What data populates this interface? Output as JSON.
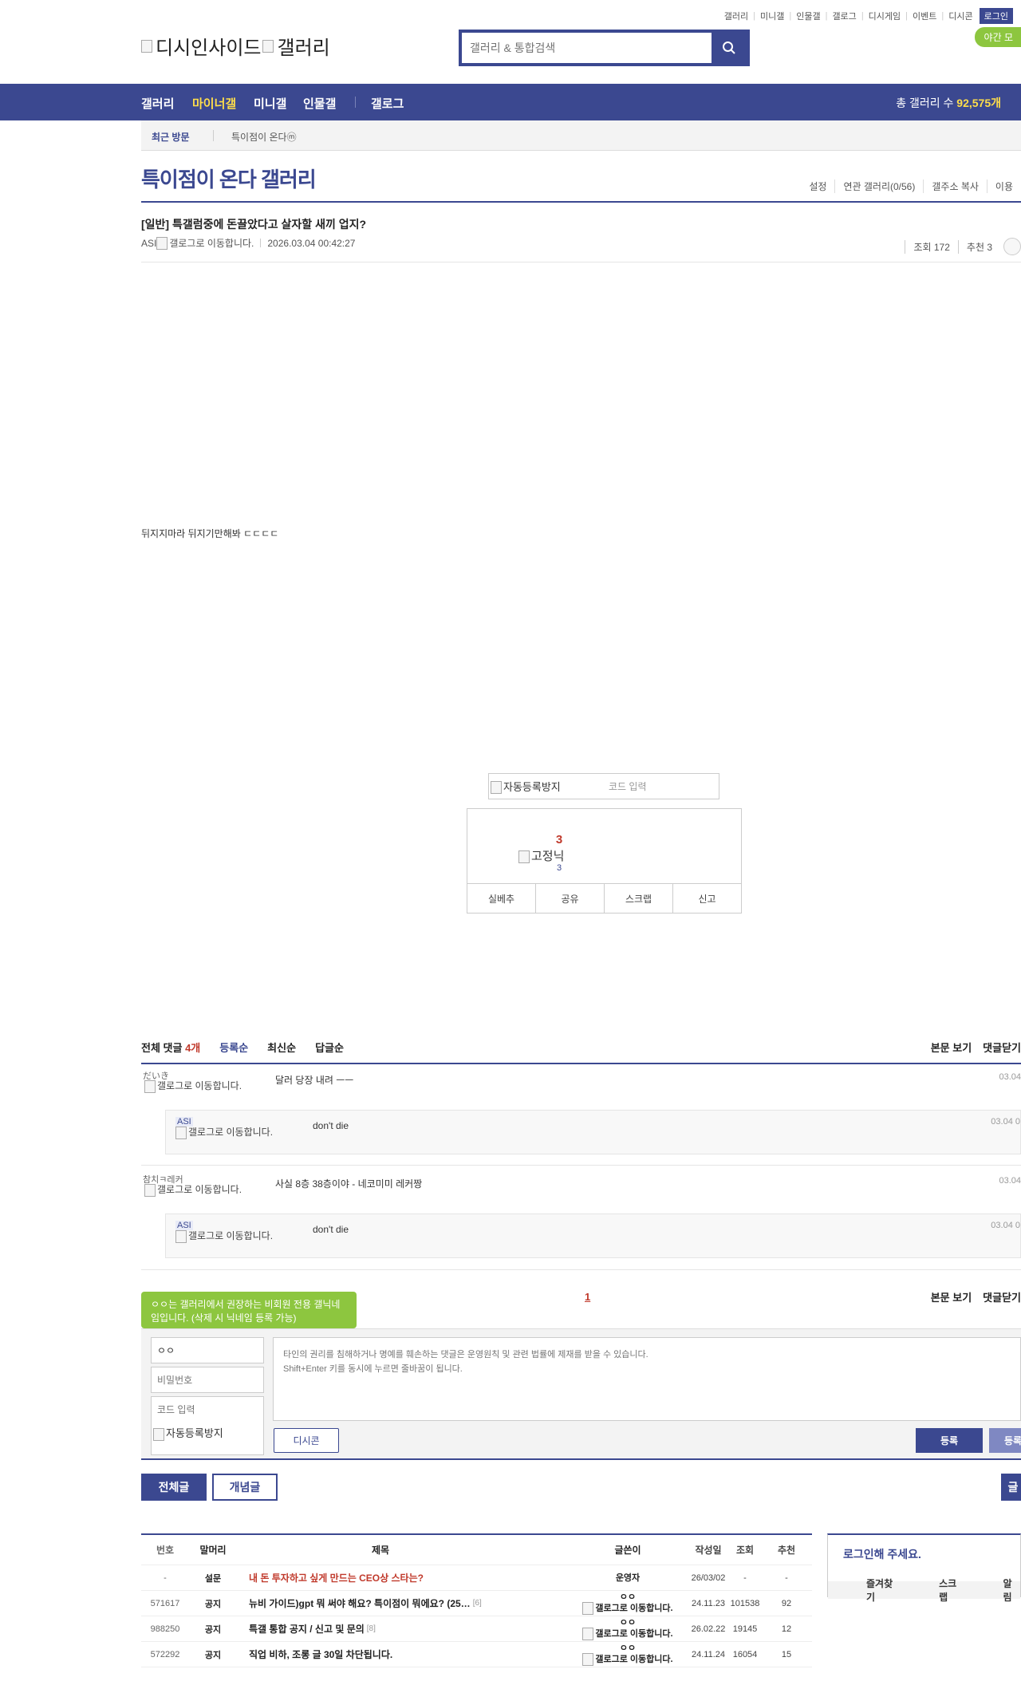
{
  "header": {
    "top_links": [
      "갤러리",
      "미니갤",
      "인물갤",
      "갤로그",
      "디시게임",
      "이벤트",
      "디시콘"
    ],
    "login": "로그인",
    "night_mode": "야간 모",
    "logo_alt_1": "디시인사이드",
    "logo_alt_2": "갤러리",
    "search_placeholder": "갤러리 & 통합검색"
  },
  "gnb": {
    "items": [
      "갤러리",
      "마이너갤",
      "미니갤",
      "인물갤",
      "갤로그"
    ],
    "count_label": "총 갤러리 수",
    "count_value": "92,575개"
  },
  "recent": {
    "label": "최근 방문",
    "item": "특이점이 온다ⓜ"
  },
  "gallery": {
    "title": "특이점이 온다 갤러리",
    "links": [
      "설정",
      "연관 갤러리(0/56)",
      "갤주소 복사",
      "이용"
    ]
  },
  "post": {
    "title": "[일반] 특갤럼중에 돈끌았다고 살자할 새끼 업지?",
    "author": "ASI",
    "gallog_alt": "갤로그로 이동합니다.",
    "date": "2026.03.04 00:42:27",
    "views": "조회 172",
    "recommend": "추천 3",
    "body": "뒤지지마라 뒤지기만해봐 ㄷㄷㄷㄷ"
  },
  "captcha": {
    "img_alt": "자동등록방지",
    "code_placeholder": "코드 입력"
  },
  "recommend_box": {
    "count": "3",
    "fixed_alt": "고정닉",
    "fixed_count": "3",
    "buttons": [
      "실베추",
      "공유",
      "스크랩",
      "신고"
    ]
  },
  "comments": {
    "total_label": "전체 댓글",
    "total_count": "4개",
    "sort": [
      "등록순",
      "최신순",
      "답글순"
    ],
    "right_links": [
      "본문 보기",
      "댓글닫기"
    ],
    "gallog_alt": "갤로그로 이동합니다.",
    "items": [
      {
        "nick": "だいき",
        "text": "달러 당장 내려 ㅡㅡ",
        "date": "03.04"
      },
      {
        "nick": "ASI",
        "text": "don't die",
        "date": "03.04 0"
      },
      {
        "nick": "참치ㅋ레커",
        "text": "사실 8층 38층이야 - 네코미미 레커짱",
        "date": "03.04"
      },
      {
        "nick": "ASI",
        "text": "don't die",
        "date": "03.04 0"
      }
    ],
    "page": "1"
  },
  "writer": {
    "tooltip": "ㅇㅇ는 갤러리에서 권장하는 비회원 전용 갤닉네임입니다. (삭제 시 닉네임 등록 가능)",
    "nick_value": "ㅇㅇ",
    "password_placeholder": "비밀번호",
    "code_placeholder": "코드 입력",
    "captcha_alt": "자동등록방지",
    "textarea_placeholder": "타인의 권리를 침해하거나 명예를 훼손하는 댓글은 운영원칙 및 관련 법률에 제재를 받을 수 있습니다.\nShift+Enter 키를 동시에 누르면 줄바꿈이 됩니다.",
    "dccon": "디시콘",
    "submit": "등록",
    "submit2": "등록"
  },
  "tabs": {
    "all": "전체글",
    "best": "개념글",
    "edge": "글"
  },
  "board": {
    "headers": {
      "num": "번호",
      "sub": "말머리",
      "title": "제목",
      "writer": "글쓴이",
      "date": "작성일",
      "views": "조회",
      "recom": "추천"
    },
    "rows": [
      {
        "num": "-",
        "sub": "설문",
        "title": "내 돈 투자하고 싶게 만드는 CEO상 스타는?",
        "rcount": "",
        "writer": "운영자",
        "date": "26/03/02",
        "views": "-",
        "recom": "-"
      },
      {
        "num": "571617",
        "sub": "공지",
        "title": "뉴비 가이드)gpt 뭐 써야 해요? 특이점이 뭐에요? (25…",
        "rcount": "[6]",
        "writer": "ㅇㅇ",
        "date": "24.11.23",
        "views": "101538",
        "recom": "92"
      },
      {
        "num": "988250",
        "sub": "공지",
        "title": "특갤 통합 공지 / 신고 및 문의",
        "rcount": "[8]",
        "writer": "ㅇㅇ",
        "date": "26.02.22",
        "views": "19145",
        "recom": "12"
      },
      {
        "num": "572292",
        "sub": "공지",
        "title": "직업 비하, 조롱 글 30일 차단됩니다.",
        "rcount": "",
        "writer": "ㅇㅇ",
        "date": "24.11.24",
        "views": "16054",
        "recom": "15"
      }
    ]
  },
  "login_box": {
    "title": "로그인해 주세요.",
    "links": [
      "즐겨찾기",
      "스크랩",
      "알림"
    ]
  },
  "colors": {
    "navy": "#3b4890",
    "green": "#8dc63f",
    "yellow": "#ffde4a",
    "red": "#c0392b"
  }
}
